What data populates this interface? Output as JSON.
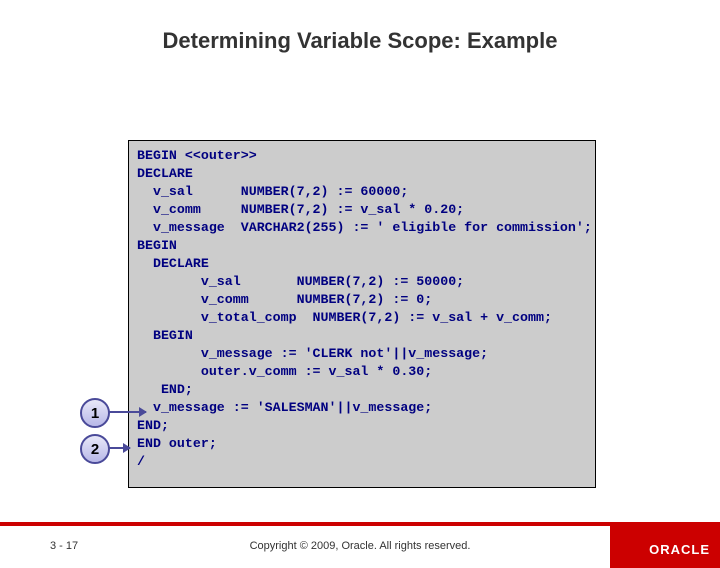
{
  "title": "Determining Variable Scope: Example",
  "code": "BEGIN <<outer>>\nDECLARE\n  v_sal      NUMBER(7,2) := 60000;\n  v_comm     NUMBER(7,2) := v_sal * 0.20;\n  v_message  VARCHAR2(255) := ' eligible for commission';\nBEGIN\n  DECLARE\n        v_sal       NUMBER(7,2) := 50000;\n        v_comm      NUMBER(7,2) := 0;\n        v_total_comp  NUMBER(7,2) := v_sal + v_comm;\n  BEGIN\n        v_message := 'CLERK not'||v_message;\n        outer.v_comm := v_sal * 0.30;\n   END;\n  v_message := 'SALESMAN'||v_message;\nEND;\nEND outer;\n/",
  "callouts": {
    "c1": "1",
    "c2": "2"
  },
  "footer": {
    "page": "3 - 17",
    "copyright": "Copyright © 2009, Oracle. All rights reserved.",
    "logo": "ORACLE"
  }
}
